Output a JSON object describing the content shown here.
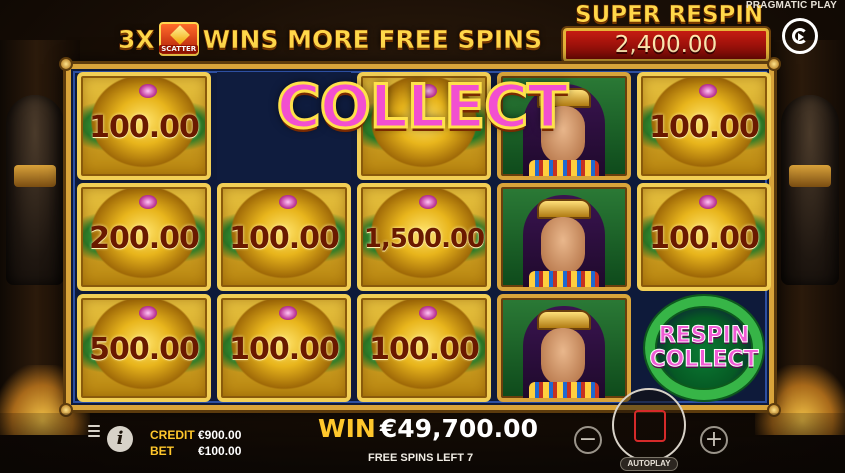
{
  "brand": "PRAGMATIC PLAY",
  "banner": {
    "prefix": "3X",
    "scatter_label": "SCATTER",
    "text": "WINS MORE FREE SPINS"
  },
  "super_respin": {
    "title": "SUPER RESPIN",
    "amount": "2,400.00"
  },
  "collect_banner": "COLLECT",
  "grid": {
    "rows": [
      [
        {
          "type": "coin",
          "value": "100.00"
        },
        {
          "type": "empty",
          "value": ""
        },
        {
          "type": "coin",
          "value": ""
        },
        {
          "type": "queen",
          "value": ""
        },
        {
          "type": "coin",
          "value": "100.00"
        }
      ],
      [
        {
          "type": "coin",
          "value": "200.00"
        },
        {
          "type": "coin",
          "value": "100.00"
        },
        {
          "type": "coin",
          "value": "1,500.00"
        },
        {
          "type": "queen",
          "value": ""
        },
        {
          "type": "coin",
          "value": "100.00"
        }
      ],
      [
        {
          "type": "coin",
          "value": "500.00"
        },
        {
          "type": "coin",
          "value": "100.00"
        },
        {
          "type": "coin",
          "value": "100.00"
        },
        {
          "type": "queen",
          "value": ""
        },
        {
          "type": "respin_collect",
          "value": "RESPIN COLLECT"
        }
      ]
    ]
  },
  "cells": {
    "r0c0": "100.00",
    "r0c4": "100.00",
    "r1c0": "200.00",
    "r1c1": "100.00",
    "r1c2": "1,500.00",
    "r1c4": "100.00",
    "r2c0": "500.00",
    "r2c1": "100.00",
    "r2c2": "100.00",
    "respin_line1": "RESPIN",
    "respin_line2": "COLLECT"
  },
  "bottom": {
    "credit_label": "CREDIT",
    "credit_value": "€900.00",
    "bet_label": "BET",
    "bet_value": "€100.00",
    "win_label": "WIN",
    "win_value": "€49,700.00",
    "free_spins_left": "FREE SPINS LEFT 7",
    "autoplay_label": "AUTOPLAY",
    "minus": "−",
    "plus": "+",
    "info": "i"
  },
  "colors": {
    "gold": "#ffd84a",
    "collect_pink": "#f24fd0",
    "respin_red": "#c51b12",
    "label_yellow": "#ffc72c"
  }
}
